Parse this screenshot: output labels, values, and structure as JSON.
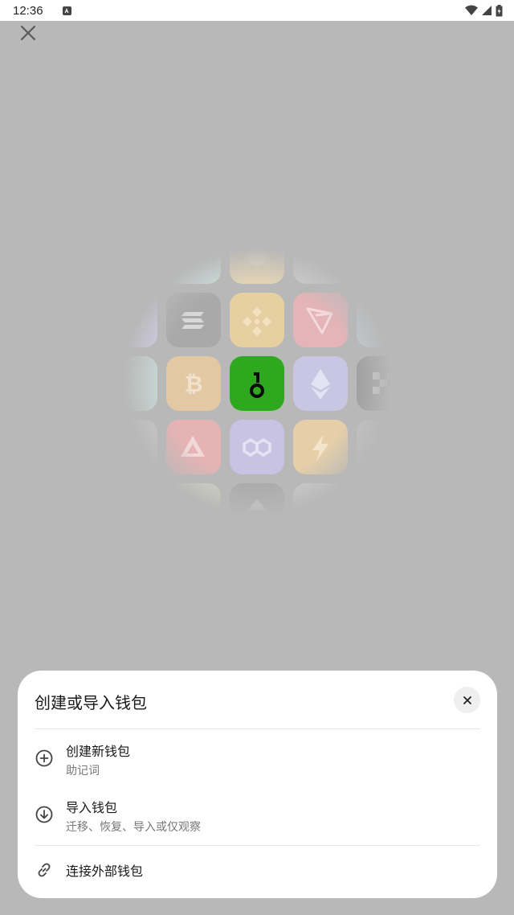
{
  "status_bar": {
    "time": "12:36",
    "icons": [
      "app-notification-icon",
      "wifi-icon",
      "signal-icon",
      "battery-icon"
    ]
  },
  "background": {
    "close_icon": "close-icon",
    "tiles": [
      {
        "name": "tile-partial-top-left",
        "icon": "blank",
        "color": "#cfe3e0"
      },
      {
        "name": "tile-partial-top-middle",
        "icon": "coin",
        "color": "#e8d7b6"
      },
      {
        "name": "tile-partial-top-right",
        "icon": "mountain",
        "color": "#cfcfcf"
      },
      {
        "name": "tile-partial-left",
        "icon": "tetra",
        "color": "#d6d0ea"
      },
      {
        "name": "tile-solana",
        "icon": "solana",
        "color": "#a9a9a9"
      },
      {
        "name": "tile-bnb",
        "icon": "bnb",
        "color": "#e6cfa0"
      },
      {
        "name": "tile-tron",
        "icon": "tron",
        "color": "#e5b4b8"
      },
      {
        "name": "tile-partial-right",
        "icon": "dots",
        "color": "#c4ccd1"
      },
      {
        "name": "tile-partial-left-mid",
        "icon": "blank",
        "color": "#c9d8d5"
      },
      {
        "name": "tile-bitcoin",
        "icon": "bitcoin",
        "color": "#e3c8a4"
      },
      {
        "name": "tile-onekey",
        "icon": "onekey",
        "color": "#2ea81e"
      },
      {
        "name": "tile-ethereum",
        "icon": "ethereum",
        "color": "#c8c6e3"
      },
      {
        "name": "tile-partial-right-mid",
        "icon": "checker",
        "color": "#9c9c9c"
      },
      {
        "name": "tile-partial-left-low",
        "icon": "apt",
        "color": "#c9c9c9"
      },
      {
        "name": "tile-avalanche",
        "icon": "avalanche",
        "color": "#e5b3b3"
      },
      {
        "name": "tile-polygon",
        "icon": "polygon",
        "color": "#c8c3e2"
      },
      {
        "name": "tile-bolt",
        "icon": "bolt",
        "color": "#e6cfa8"
      },
      {
        "name": "tile-partial-right-low",
        "icon": "shield",
        "color": "#c4c4c4"
      },
      {
        "name": "tile-partial-bottom-left",
        "icon": "blank",
        "color": "#d4d9c4"
      },
      {
        "name": "tile-partial-bottom-middle",
        "icon": "arrow-up",
        "color": "#a9a9a9"
      },
      {
        "name": "tile-partial-bottom-right",
        "icon": "blank",
        "color": "#cfcfcf"
      }
    ]
  },
  "sheet": {
    "title": "创建或导入钱包",
    "close_icon": "close-icon",
    "options": [
      {
        "icon": "plus-circle-icon",
        "label": "创建新钱包",
        "sub": "助记词"
      },
      {
        "icon": "download-circle-icon",
        "label": "导入钱包",
        "sub": "迁移、恢复、导入或仅观察"
      },
      {
        "icon": "link-icon",
        "label": "连接外部钱包",
        "sub": ""
      }
    ]
  }
}
